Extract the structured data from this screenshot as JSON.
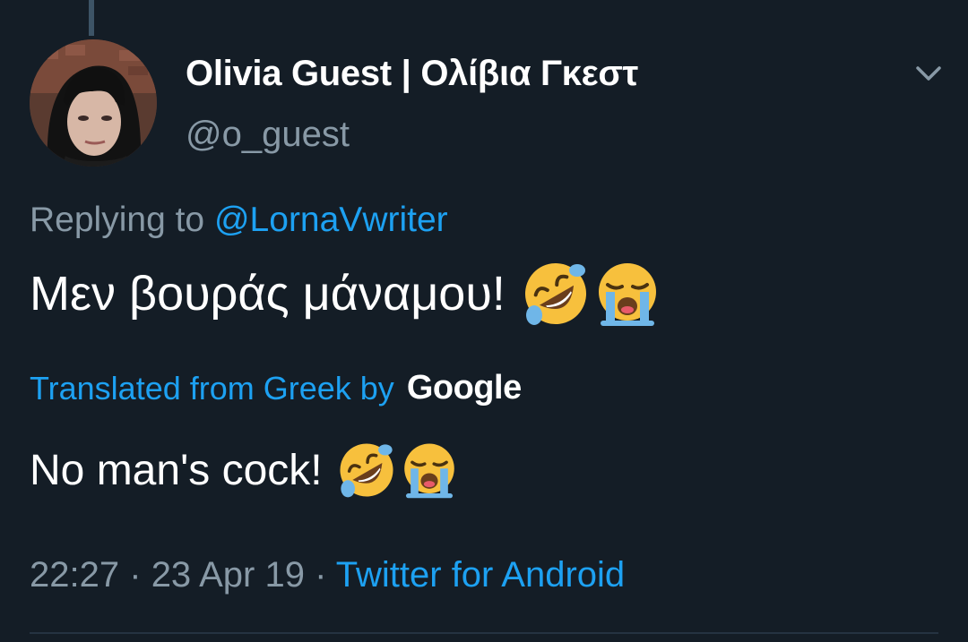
{
  "tweet": {
    "author": {
      "display_name": "Olivia Guest | Ολίβια Γκεστ",
      "handle": "@o_guest"
    },
    "menu_icon": "chevron-down-icon",
    "reply": {
      "prefix": "Replying to",
      "mention": "@LornaVwriter"
    },
    "text": "Μεν βουράς μάναμου!",
    "emojis": [
      "rolling-on-floor-laughing-emoji",
      "loudly-crying-face-emoji"
    ],
    "translation": {
      "label": "Translated from Greek by",
      "provider": "Google",
      "text": "No man's cock!"
    },
    "meta": {
      "time": "22:27",
      "separator": "·",
      "date": "23 Apr 19",
      "source": "Twitter for Android"
    },
    "colors": {
      "background": "#141d26",
      "accent": "#1da1f2",
      "muted": "#8899a6",
      "divider": "#253341"
    }
  }
}
